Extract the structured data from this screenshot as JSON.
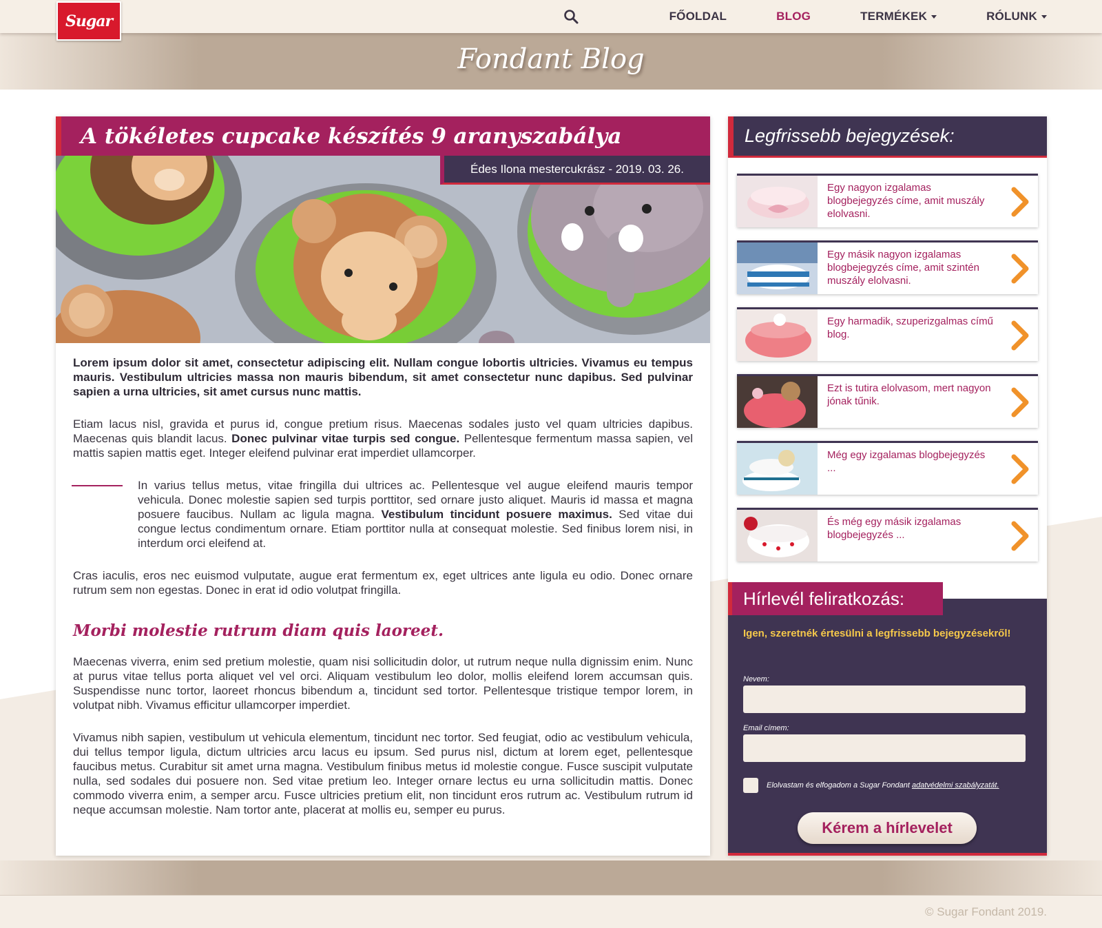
{
  "logo": {
    "text": "Sugar"
  },
  "nav": {
    "items": [
      {
        "label": "FŐOLDAL",
        "active": false,
        "dropdown": false
      },
      {
        "label": "BLOG",
        "active": true,
        "dropdown": false
      },
      {
        "label": "TERMÉKEK",
        "active": false,
        "dropdown": true
      },
      {
        "label": "RÓLUNK",
        "active": false,
        "dropdown": true
      }
    ]
  },
  "banner": {
    "title": "Fondant Blog"
  },
  "article": {
    "title": "A tökéletes cupcake készítés 9 aranyszabálya",
    "byline": "Édes Ilona mestercukrász - 2019. 03. 26.",
    "lead": "Lorem ipsum dolor sit amet, consectetur adipiscing elit. Nullam congue lobortis ultricies. Vivamus eu tempus mauris. Vestibulum ultricies massa non mauris bibendum, sit amet consectetur nunc dapibus. Sed pulvinar sapien a urna ultricies, sit amet cursus nunc mattis.",
    "p2_a": "Etiam lacus nisl, gravida et purus id, congue pretium risus. Maecenas sodales justo vel quam ultricies dapibus. Maecenas quis blandit lacus. ",
    "p2_b": "Donec pulvinar vitae turpis sed congue.",
    "p2_c": " Pellentesque fermentum massa sapien, vel mattis sapien mattis eget. Integer eleifend pulvinar erat imperdiet ullamcorper.",
    "quote_a": "In varius tellus metus, vitae fringilla dui ultrices ac. Pellentesque vel augue eleifend mauris tempor vehicula. Donec molestie sapien sed turpis porttitor, sed ornare justo aliquet. Mauris id massa et magna posuere faucibus. Nullam ac ligula magna. ",
    "quote_b": "Vestibulum tincidunt posuere maximus.",
    "quote_c": " Sed vitae dui congue lectus condimentum ornare. Etiam porttitor nulla at consequat molestie. Sed finibus lorem nisi, in interdum orci eleifend at.",
    "p4": "Cras iaculis, eros nec euismod vulputate, augue erat fermentum ex, eget ultrices ante ligula eu odio. Donec ornare rutrum sem non egestas. Donec in erat id odio volutpat fringilla.",
    "subheading": "Morbi molestie rutrum diam quis laoreet.",
    "p5": " Maecenas viverra, enim sed pretium molestie, quam nisi sollicitudin dolor, ut rutrum neque nulla dignissim enim. Nunc at purus vitae tellus porta aliquet vel vel orci. Aliquam vestibulum leo dolor, mollis eleifend lorem accumsan quis. Suspendisse nunc tortor, laoreet rhoncus bibendum a, tincidunt sed tortor. Pellentesque tristique tempor lorem, in volutpat nibh. Vivamus efficitur ullamcorper imperdiet.",
    "p6": "Vivamus nibh sapien, vestibulum ut vehicula elementum, tincidunt nec tortor. Sed feugiat, odio ac vestibulum vehicula, dui tellus tempor ligula, dictum ultricies arcu lacus eu ipsum. Sed purus nisl, dictum at lorem eget, pellentesque faucibus metus. Curabitur sit amet urna magna. Vestibulum finibus metus id molestie congue. Fusce suscipit vulputate nulla, sed sodales dui posuere non. Sed vitae pretium leo. Integer ornare lectus eu urna sollicitudin mattis. Donec commodo viverra enim, a semper arcu. Fusce ultricies pretium elit, non tincidunt eros rutrum ac. Vestibulum rutrum id neque accumsan molestie. Nam tortor ante, placerat at mollis eu, semper eu purus."
  },
  "sidebar": {
    "title": "Legfrissebb bejegyzések:",
    "posts": [
      {
        "title": "Egy nagyon izgalamas blogbejegyzés címe, amit muszály elolvasni."
      },
      {
        "title": "Egy másik nagyon izgalamas blogbejegyzés címe, amit szintén muszály elolvasni."
      },
      {
        "title": "Egy harmadik, szuperizgalmas című blog."
      },
      {
        "title": "Ezt is tutira elolvasom, mert nagyon jónak tűnik."
      },
      {
        "title": "Még egy izgalamas blogbejegyzés ..."
      },
      {
        "title": "És még egy másik izgalamas blogbejegyzés ..."
      }
    ]
  },
  "newsletter": {
    "title": "Hírlevél feliratkozás:",
    "subtitle": "Igen, szeretnék értesülni a legfrissebb bejegyzésekről!",
    "name_label": "Nevem:",
    "email_label": "Email címem:",
    "consent_prefix": "Elolvastam és elfogadom a Sugar Fondant ",
    "consent_link": "adatvédelmi szabályzatát.",
    "button": "Kérem a hírlevelet"
  },
  "footer": {
    "copyright": "© Sugar Fondant 2019."
  },
  "colors": {
    "accent": "#a4215e",
    "dark": "#3f3452",
    "red": "#d12a3c",
    "arrow": "#f0922a"
  }
}
